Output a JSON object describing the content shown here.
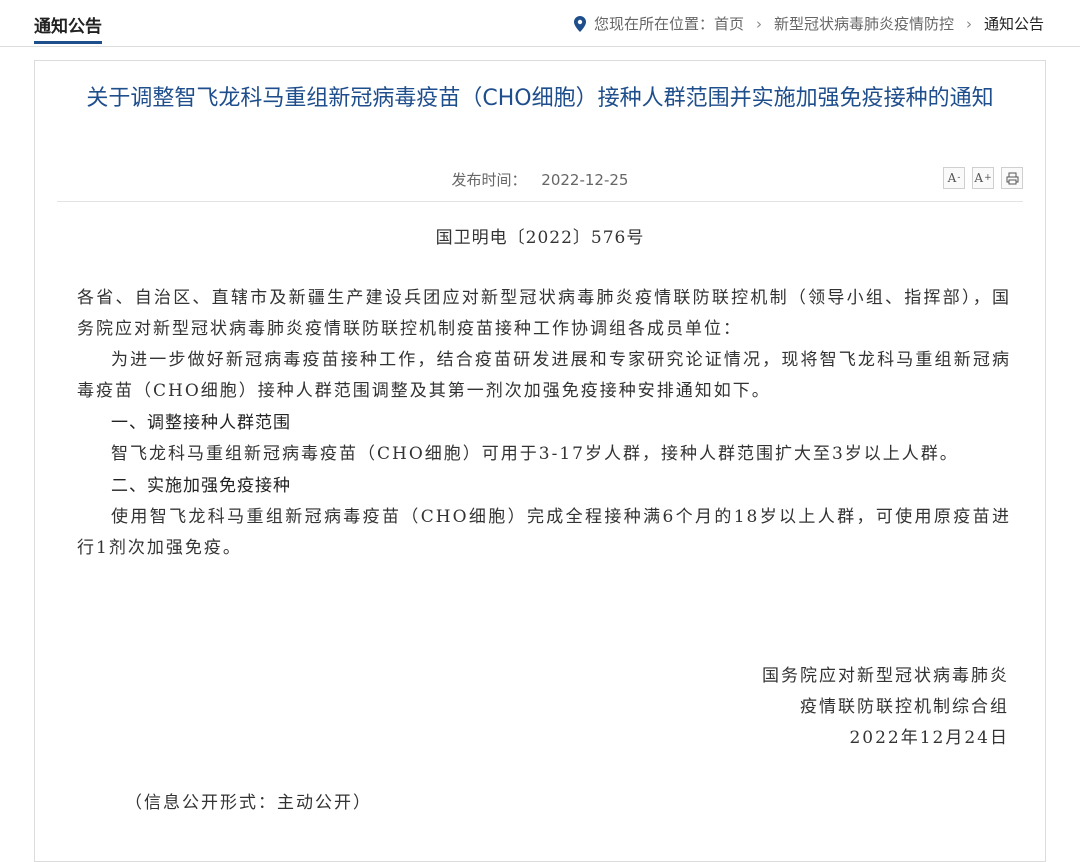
{
  "header": {
    "section_title": "通知公告",
    "location_label": "您现在所在位置：",
    "breadcrumb": [
      "首页",
      "新型冠状病毒肺炎疫情防控",
      "通知公告"
    ],
    "separator": "›"
  },
  "article": {
    "title": "关于调整智飞龙科马重组新冠病毒疫苗（CHO细胞）接种人群范围并实施加强免疫接种的通知",
    "publish_label": "发布时间：",
    "publish_date": "2022-12-25",
    "tools": {
      "font_decrease": "A",
      "font_increase": "A",
      "print": "print"
    },
    "doc_number": "国卫明电〔2022〕576号",
    "salutation": "各省、自治区、直辖市及新疆生产建设兵团应对新型冠状病毒肺炎疫情联防联控机制（领导小组、指挥部），国务院应对新型冠状病毒肺炎疫情联防联控机制疫苗接种工作协调组各成员单位：",
    "intro": "为进一步做好新冠病毒疫苗接种工作，结合疫苗研发进展和专家研究论证情况，现将智飞龙科马重组新冠病毒疫苗（CHO细胞）接种人群范围调整及其第一剂次加强免疫接种安排通知如下。",
    "section1_heading": "一、调整接种人群范围",
    "section1_text": "智飞龙科马重组新冠病毒疫苗（CHO细胞）可用于3-17岁人群，接种人群范围扩大至3岁以上人群。",
    "section2_heading": "二、实施加强免疫接种",
    "section2_text": "使用智飞龙科马重组新冠病毒疫苗（CHO细胞）完成全程接种满6个月的18岁以上人群，可使用原疫苗进行1剂次加强免疫。",
    "signature_line1": "国务院应对新型冠状病毒肺炎",
    "signature_line2": "疫情联防联控机制综合组",
    "signature_date": "2022年12月24日",
    "disclosure": "（信息公开形式：主动公开）"
  },
  "colors": {
    "accent": "#1f4e8c",
    "border": "#dcdcdc",
    "text": "#333333",
    "muted": "#666666"
  }
}
